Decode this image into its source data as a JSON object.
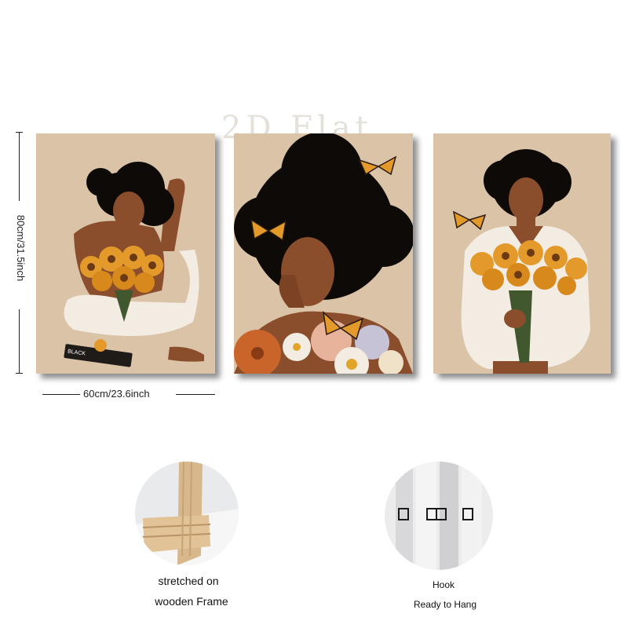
{
  "watermark": "2D Flat",
  "dimensions": {
    "height_label": "80cm/31.5inch",
    "width_label": "60cm/23.6inch"
  },
  "panels": [
    {
      "name": "woman-with-sunflowers-seated"
    },
    {
      "name": "woman-with-butterflies-and-flowers"
    },
    {
      "name": "woman-in-white-with-sunflowers"
    }
  ],
  "book_text": "BLACK",
  "details": {
    "frame_caption_line1": "stretched on",
    "frame_caption_line2": "wooden Frame",
    "hook_caption_line1": "Hook",
    "hook_caption_line2": "Ready to Hang"
  },
  "colors": {
    "canvas_bg": "#dbc3a8",
    "skin": "#8a4e2c",
    "hair": "#0e0a08",
    "sunflower": "#e39a2a",
    "white_cloth": "#f3ece2",
    "wood": "#d9b78c"
  }
}
